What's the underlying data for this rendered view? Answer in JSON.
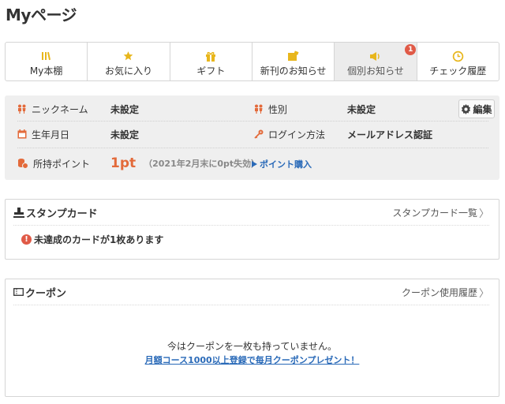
{
  "page": {
    "title": "Myページ"
  },
  "tabs": [
    {
      "label": "My本棚",
      "icon": "bookshelf-icon"
    },
    {
      "label": "お気に入り",
      "icon": "star-icon"
    },
    {
      "label": "ギフト",
      "icon": "gift-icon"
    },
    {
      "label": "新刊のお知らせ",
      "icon": "new-arrivals-icon"
    },
    {
      "label": "個別お知らせ",
      "icon": "megaphone-icon",
      "active": true,
      "badge": "1"
    },
    {
      "label": "チェック履歴",
      "icon": "clock-icon"
    }
  ],
  "profile": {
    "nickname_label": "ニックネーム",
    "nickname_value": "未設定",
    "gender_label": "性別",
    "gender_value": "未設定",
    "birthday_label": "生年月日",
    "birthday_value": "未設定",
    "login_label": "ログイン方法",
    "login_value": "メールアドレス認証",
    "points_label": "所持ポイント",
    "points_value": "1pt",
    "points_note": "（2021年2月末に0pt失効）",
    "buy_points": "ポイント購入",
    "edit_button": "編集"
  },
  "stamp_card": {
    "title": "スタンプカード",
    "link": "スタンプカード一覧",
    "notice": "未達成のカードが1枚あります"
  },
  "coupon": {
    "title": "クーポン",
    "link": "クーポン使用履歴",
    "empty_message": "今はクーポンを一枚も持っていません。",
    "promo_link": "月額コース1000以上登録で毎月クーポンプレゼント！"
  },
  "colors": {
    "accent_orange": "#e36a3a",
    "badge_red": "#e05a47",
    "link_blue": "#2a6ab8",
    "icon_yellow": "#e8b61c"
  }
}
